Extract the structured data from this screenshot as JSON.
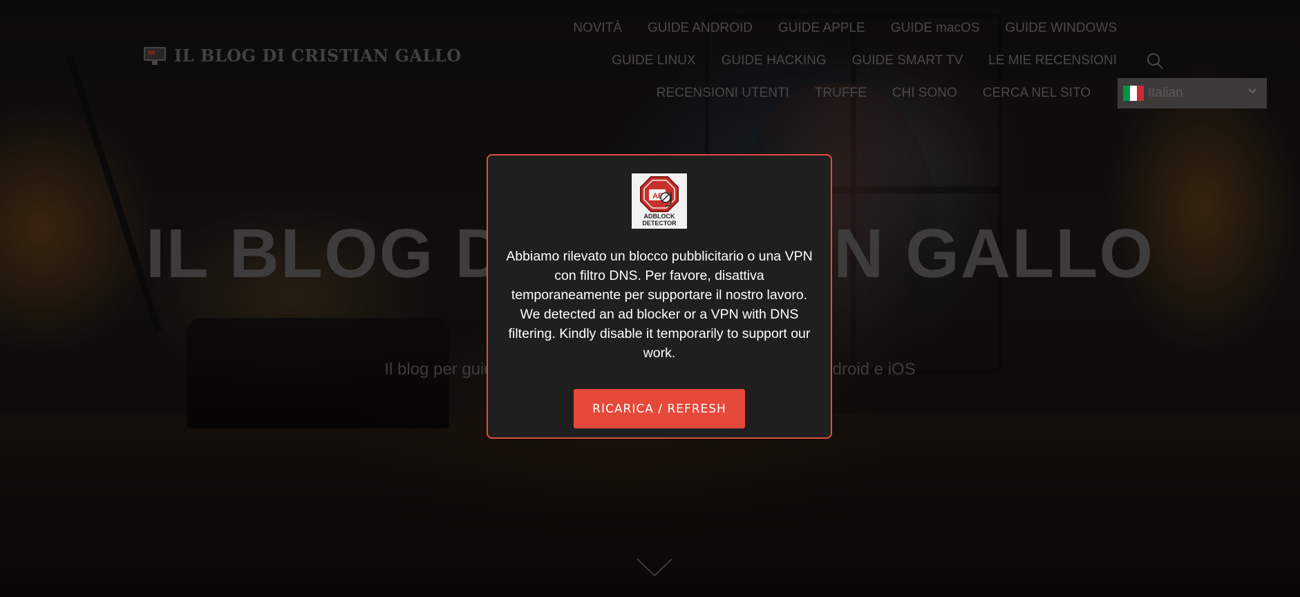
{
  "site": {
    "logo_text": "IL BLOG DI CRISTIAN GALLO"
  },
  "nav": {
    "row1": [
      "NOVITÀ",
      "GUIDE ANDROID",
      "GUIDE APPLE",
      "GUIDE macOS",
      "GUIDE WINDOWS"
    ],
    "row2": [
      "GUIDE LINUX",
      "GUIDE HACKING",
      "GUIDE SMART TV",
      "LE MIE RECENSIONI"
    ],
    "row3": [
      "RECENSIONI UTENTI",
      "TRUFFE",
      "CHI SONO",
      "CERCA NEL SITO"
    ]
  },
  "language": {
    "selected": "Italian",
    "flag_colors": [
      "#009246",
      "#ffffff",
      "#ce2b37"
    ]
  },
  "hero": {
    "title": "IL BLOG DI CRISTIAN GALLO",
    "subtitle": "Il blog per guide e recensioni su Windows, macOS, Linux, Android e iOS"
  },
  "modal": {
    "badge_text_line1": "ADBLOCK",
    "badge_text_line2": "DETECTOR",
    "badge_sign_text": "AB",
    "message": "Abbiamo rilevato un blocco pubblicitario o una VPN con filtro DNS. Per favore, disattiva temporaneamente per supportare il nostro lavoro. We detected an ad blocker or a VPN with DNS filtering. Kindly disable it temporarily to support our work.",
    "button_label": "RICARICA / REFRESH",
    "accent_color": "#e5493a"
  },
  "icons": {
    "search": "search-icon",
    "scroll": "chevron-down-icon",
    "language_dropdown": "chevron-down-icon"
  }
}
